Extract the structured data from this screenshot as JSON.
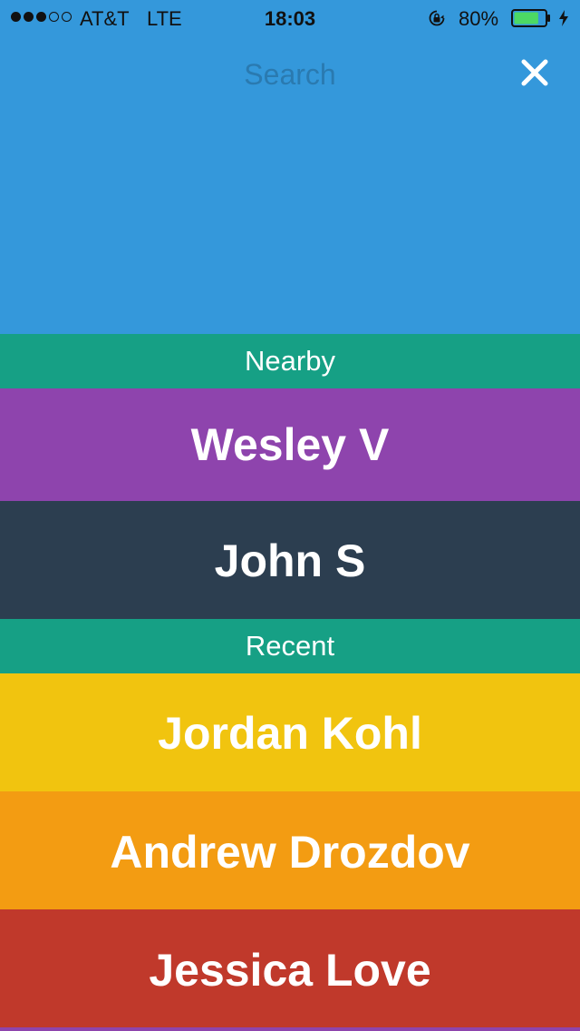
{
  "status_bar": {
    "carrier": "AT&T",
    "network": "LTE",
    "time": "18:03",
    "battery_percent": "80%",
    "battery_level": 0.8,
    "icons": [
      "signal-dots",
      "rotation-lock-icon",
      "battery-icon",
      "charging-bolt-icon"
    ]
  },
  "search": {
    "placeholder": "Search"
  },
  "colors": {
    "header_bg": "#3498db",
    "section_bg": "#16a085",
    "wesley": "#8e44ad",
    "john": "#2c3e50",
    "jordan": "#f1c40f",
    "andrew": "#f39c12",
    "jessica": "#c0392b"
  },
  "sections": {
    "nearby": {
      "label": "Nearby",
      "people": [
        {
          "name": "Wesley V"
        },
        {
          "name": "John S"
        }
      ]
    },
    "recent": {
      "label": "Recent",
      "people": [
        {
          "name": "Jordan Kohl"
        },
        {
          "name": "Andrew Drozdov"
        },
        {
          "name": "Jessica Love"
        }
      ]
    }
  }
}
